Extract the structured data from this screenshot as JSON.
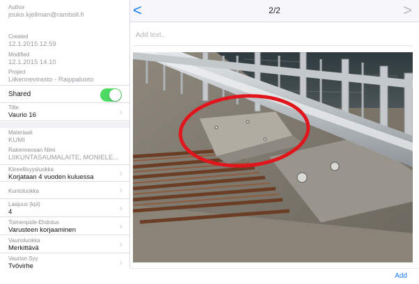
{
  "sidebar": {
    "author": {
      "label": "Author",
      "value": "jouko.kjellman@ramboll.fi"
    },
    "created": {
      "label": "Created",
      "value": "12.1.2015 12.59"
    },
    "modified": {
      "label": "Modified",
      "value": "12.1.2015 14.10"
    },
    "project": {
      "label": "Project",
      "value": "Liikennevirasto - Raippaluoto"
    },
    "shared": {
      "label": "Shared",
      "on": true
    },
    "title": {
      "label": "Title",
      "value": "Vaurio 16"
    },
    "materiaali": {
      "label": "Materiaali",
      "value": "KUMI"
    },
    "rakenneosa": {
      "label": "Rakenneosan Nimi",
      "value": "LIIKUNTASAUMALAITE, MONIELE..."
    },
    "kiireellisyys": {
      "label": "Kiireellisyysluokka",
      "value": "Korjataan 4 vuoden kuluessa"
    },
    "kuntoluokka": {
      "label": "Kuntoluokka",
      "value": ""
    },
    "laajuus": {
      "label": "Laajuus (kpl)",
      "value": "4"
    },
    "toimenpide": {
      "label": "Toimenpide-Ehdotus",
      "value": "Varusteen korjaaminen"
    },
    "vaurioluokka": {
      "label": "Vaurioluokka",
      "value": "Merkittävä"
    },
    "syy": {
      "label": "Vaurion Syy",
      "value": "Työvirhe"
    },
    "chevron": "›"
  },
  "topbar": {
    "back": "<",
    "counter": "2/2",
    "next": ">"
  },
  "note": {
    "placeholder": "Add text.."
  },
  "bottombar": {
    "add_label": "Add"
  },
  "colors": {
    "accent": "#1a7cf5",
    "switch_on": "#4cd964",
    "annotation": "#e0161c"
  }
}
